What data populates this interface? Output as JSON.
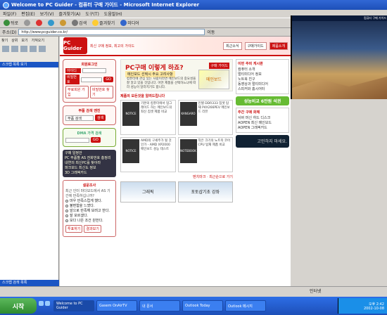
{
  "window": {
    "title": "Welcome to PC Guider - 컴퓨터 구매 가이드 - Microsoft Internet Explorer"
  },
  "menu": [
    "파일(F)",
    "편집(E)",
    "보기(V)",
    "즐겨찾기(A)",
    "도구(T)",
    "도움말(H)"
  ],
  "toolbar": {
    "back": "뒤로",
    "search": "검색",
    "favorites": "즐겨찾기",
    "media": "미디어"
  },
  "address": {
    "label": "주소(D)",
    "url": "http://www.pcguider.co.kr/",
    "go": "이동"
  },
  "left_panel": {
    "tabs": [
      "찾기",
      "상위",
      "보기",
      "가져오기"
    ],
    "section": "스크랩 목록 보기",
    "bottom": "스크랩 검색 목록"
  },
  "site": {
    "logo": "PC Guider",
    "tagline": "최신 구매 정보, 최고의 가이드",
    "nav": [
      "최근소식",
      "구매가이드",
      "제품소개"
    ],
    "login": {
      "title": "회원로그인",
      "id_label": "아이디",
      "pw_label": "비밀번호",
      "go": "GO",
      "join": "무료회원 가입",
      "find": "비밀번호 찾기"
    },
    "search_box": {
      "title": "부품 검색 엔진",
      "select": "부품 검색",
      "go": "검색"
    },
    "dma": {
      "title": "DMA 가격 검색",
      "go": "GO"
    },
    "notice": "구매 일정안\nPC 부품별 AS 전화번호 총정리\n내연의 최신PC를 찾아라\n파크보드 최신도 정보\n3D 그래픽카드",
    "poll": {
      "title": "설문조사",
      "question": "최근 인터 마더보드에서 AS 기간에 만족하십니까?",
      "options": [
        "마우 만족스럽게 했다.",
        "불편함을 느꼈다.",
        "앞으로 만족해 보려고 한다.",
        "잘 모르겠다.",
        "보다 나은 조건 원한다."
      ],
      "vote": "투표하기",
      "result": "결과보기"
    },
    "hero": {
      "title": "PC구매 이렇게 하죠?",
      "tag": "구매 가이드",
      "subtitle": "메인보드 선택시 주요 고려사항",
      "text": "컴퓨터에 관심 있는 사람이라면 메인보드의 중요성을 잘 알고 있을 것입니다. 어떤 제품을 선택하느냐에 따라 성능이 달라지기도 합니다.",
      "image": "메인보드"
    },
    "products_title": "제품의 모든것을 알려드립니다",
    "cards": [
      {
        "img": "NOTICE",
        "text": "기본의 컴퓨터에서 업그레이드 하는 메인보드의 최신 칩셋 제품 비교"
      },
      {
        "img": "KANGARO",
        "text": "인텔 DDR333 칩셋 탑재 P4X266PEV 메인보드 리뷰"
      },
      {
        "img": "NOTICE",
        "text": "AMD의 구세주가 될 것인가 - AMD XP2000 메인보드 성능 테스트"
      },
      {
        "img": "NOTEBOOK",
        "text": "작은 크기의 노트북 코어 CPU 탑재 제품 비교"
      }
    ],
    "more_1": "벤치마크",
    "more_2": "최근순으로 가기",
    "banners": [
      "그래픽",
      "포토샵기초 강좌"
    ],
    "right": {
      "box1_title": "이번 주의 게시판",
      "box1_items": [
        "컴퓨터 소개",
        "멀티미디어 정보",
        "노트북 친구",
        "동영상과 멀티미디어",
        "스피커와 홈시어터"
      ],
      "green": "성능비교 6만원 석권",
      "box2_title": "주간 구매 화제",
      "box2_items": [
        "서버 머신 하드 디스크",
        "AOPEN 최신 메인보드",
        "AOPEN 그래픽카드"
      ],
      "blue": "고민하지 마세요."
    }
  },
  "desktop": {
    "photo_title": "컴퓨터 구매 가이드"
  },
  "status": "인터넷",
  "taskbar": {
    "start": "시작",
    "tasks": [
      "Welcome to PC Guider",
      "Gasem OnAirTV",
      "내 문서",
      "Outlook Today",
      "Outlook 메시지"
    ],
    "clock": "오후 2:42",
    "date": "2002-10-08"
  }
}
